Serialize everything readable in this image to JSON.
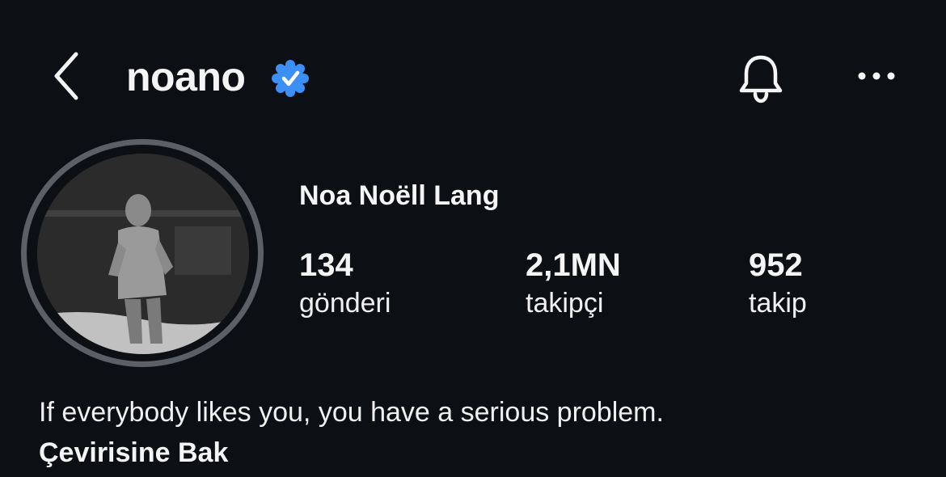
{
  "header": {
    "username": "noano",
    "back_icon": "chevron-left-icon",
    "verified_icon": "verified-badge-icon",
    "bell_icon": "bell-icon",
    "more_icon": "more-horizontal-icon"
  },
  "profile": {
    "display_name": "Noa Noëll Lang",
    "avatar_desc_icon": "profile-photo",
    "stats": [
      {
        "value": "134",
        "label": "gönderi"
      },
      {
        "value": "2,1MN",
        "label": "takipçi"
      },
      {
        "value": "952",
        "label": "takip"
      }
    ],
    "bio": "If everybody likes you, you have a serious problem.",
    "translate_label": "Çevirisine Bak"
  },
  "colors": {
    "background": "#0c0f14",
    "verified": "#3b8ff5",
    "ring": "#5b5f66",
    "text": "#f5f5f5"
  }
}
